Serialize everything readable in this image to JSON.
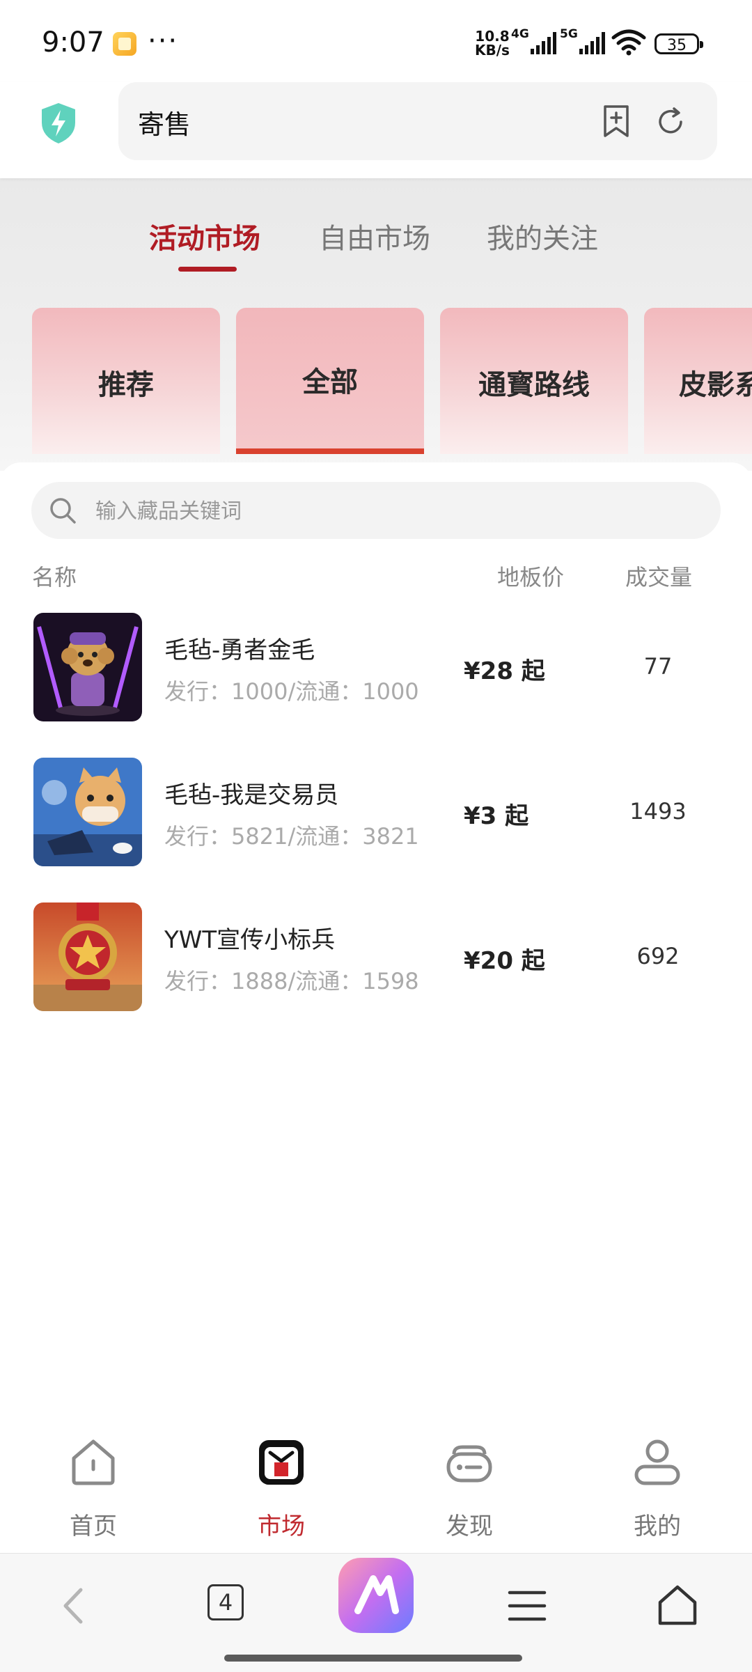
{
  "status_bar": {
    "time": "9:07",
    "more": "···",
    "net_speed_value": "10.8",
    "net_speed_unit": "KB/s",
    "sig1": "4G",
    "sig2": "5G",
    "battery": "35"
  },
  "address_bar": {
    "text": "寄售"
  },
  "tabs": [
    {
      "label": "活动市场",
      "active": true
    },
    {
      "label": "自由市场",
      "active": false
    },
    {
      "label": "我的关注",
      "active": false
    }
  ],
  "categories": [
    {
      "label": "推荐"
    },
    {
      "label": "全部",
      "active": true
    },
    {
      "label": "通寳路线"
    },
    {
      "label": "皮影系"
    }
  ],
  "search": {
    "placeholder": "输入藏品关键词"
  },
  "columns": {
    "name": "名称",
    "floor_price": "地板价",
    "volume": "成交量"
  },
  "items": [
    {
      "name": "毛毡-勇者金毛",
      "meta": "发行：1000/流通：1000",
      "price": "¥28 起",
      "volume": "77"
    },
    {
      "name": "毛毡-我是交易员",
      "meta": "发行：5821/流通：3821",
      "price": "¥3 起",
      "volume": "1493"
    },
    {
      "name": "YWT宣传小标兵",
      "meta": "发行：1888/流通：1598",
      "price": "¥20 起",
      "volume": "692"
    }
  ],
  "bottom_nav": [
    {
      "label": "首页",
      "icon": "home-icon"
    },
    {
      "label": "市场",
      "icon": "market-icon",
      "active": true
    },
    {
      "label": "发现",
      "icon": "discover-icon"
    },
    {
      "label": "我的",
      "icon": "profile-icon"
    }
  ],
  "browser_bar": {
    "tab_count": "4"
  },
  "colors": {
    "accent": "#b01c24",
    "card": "#f2b9bd",
    "indicator": "#d9422f"
  }
}
